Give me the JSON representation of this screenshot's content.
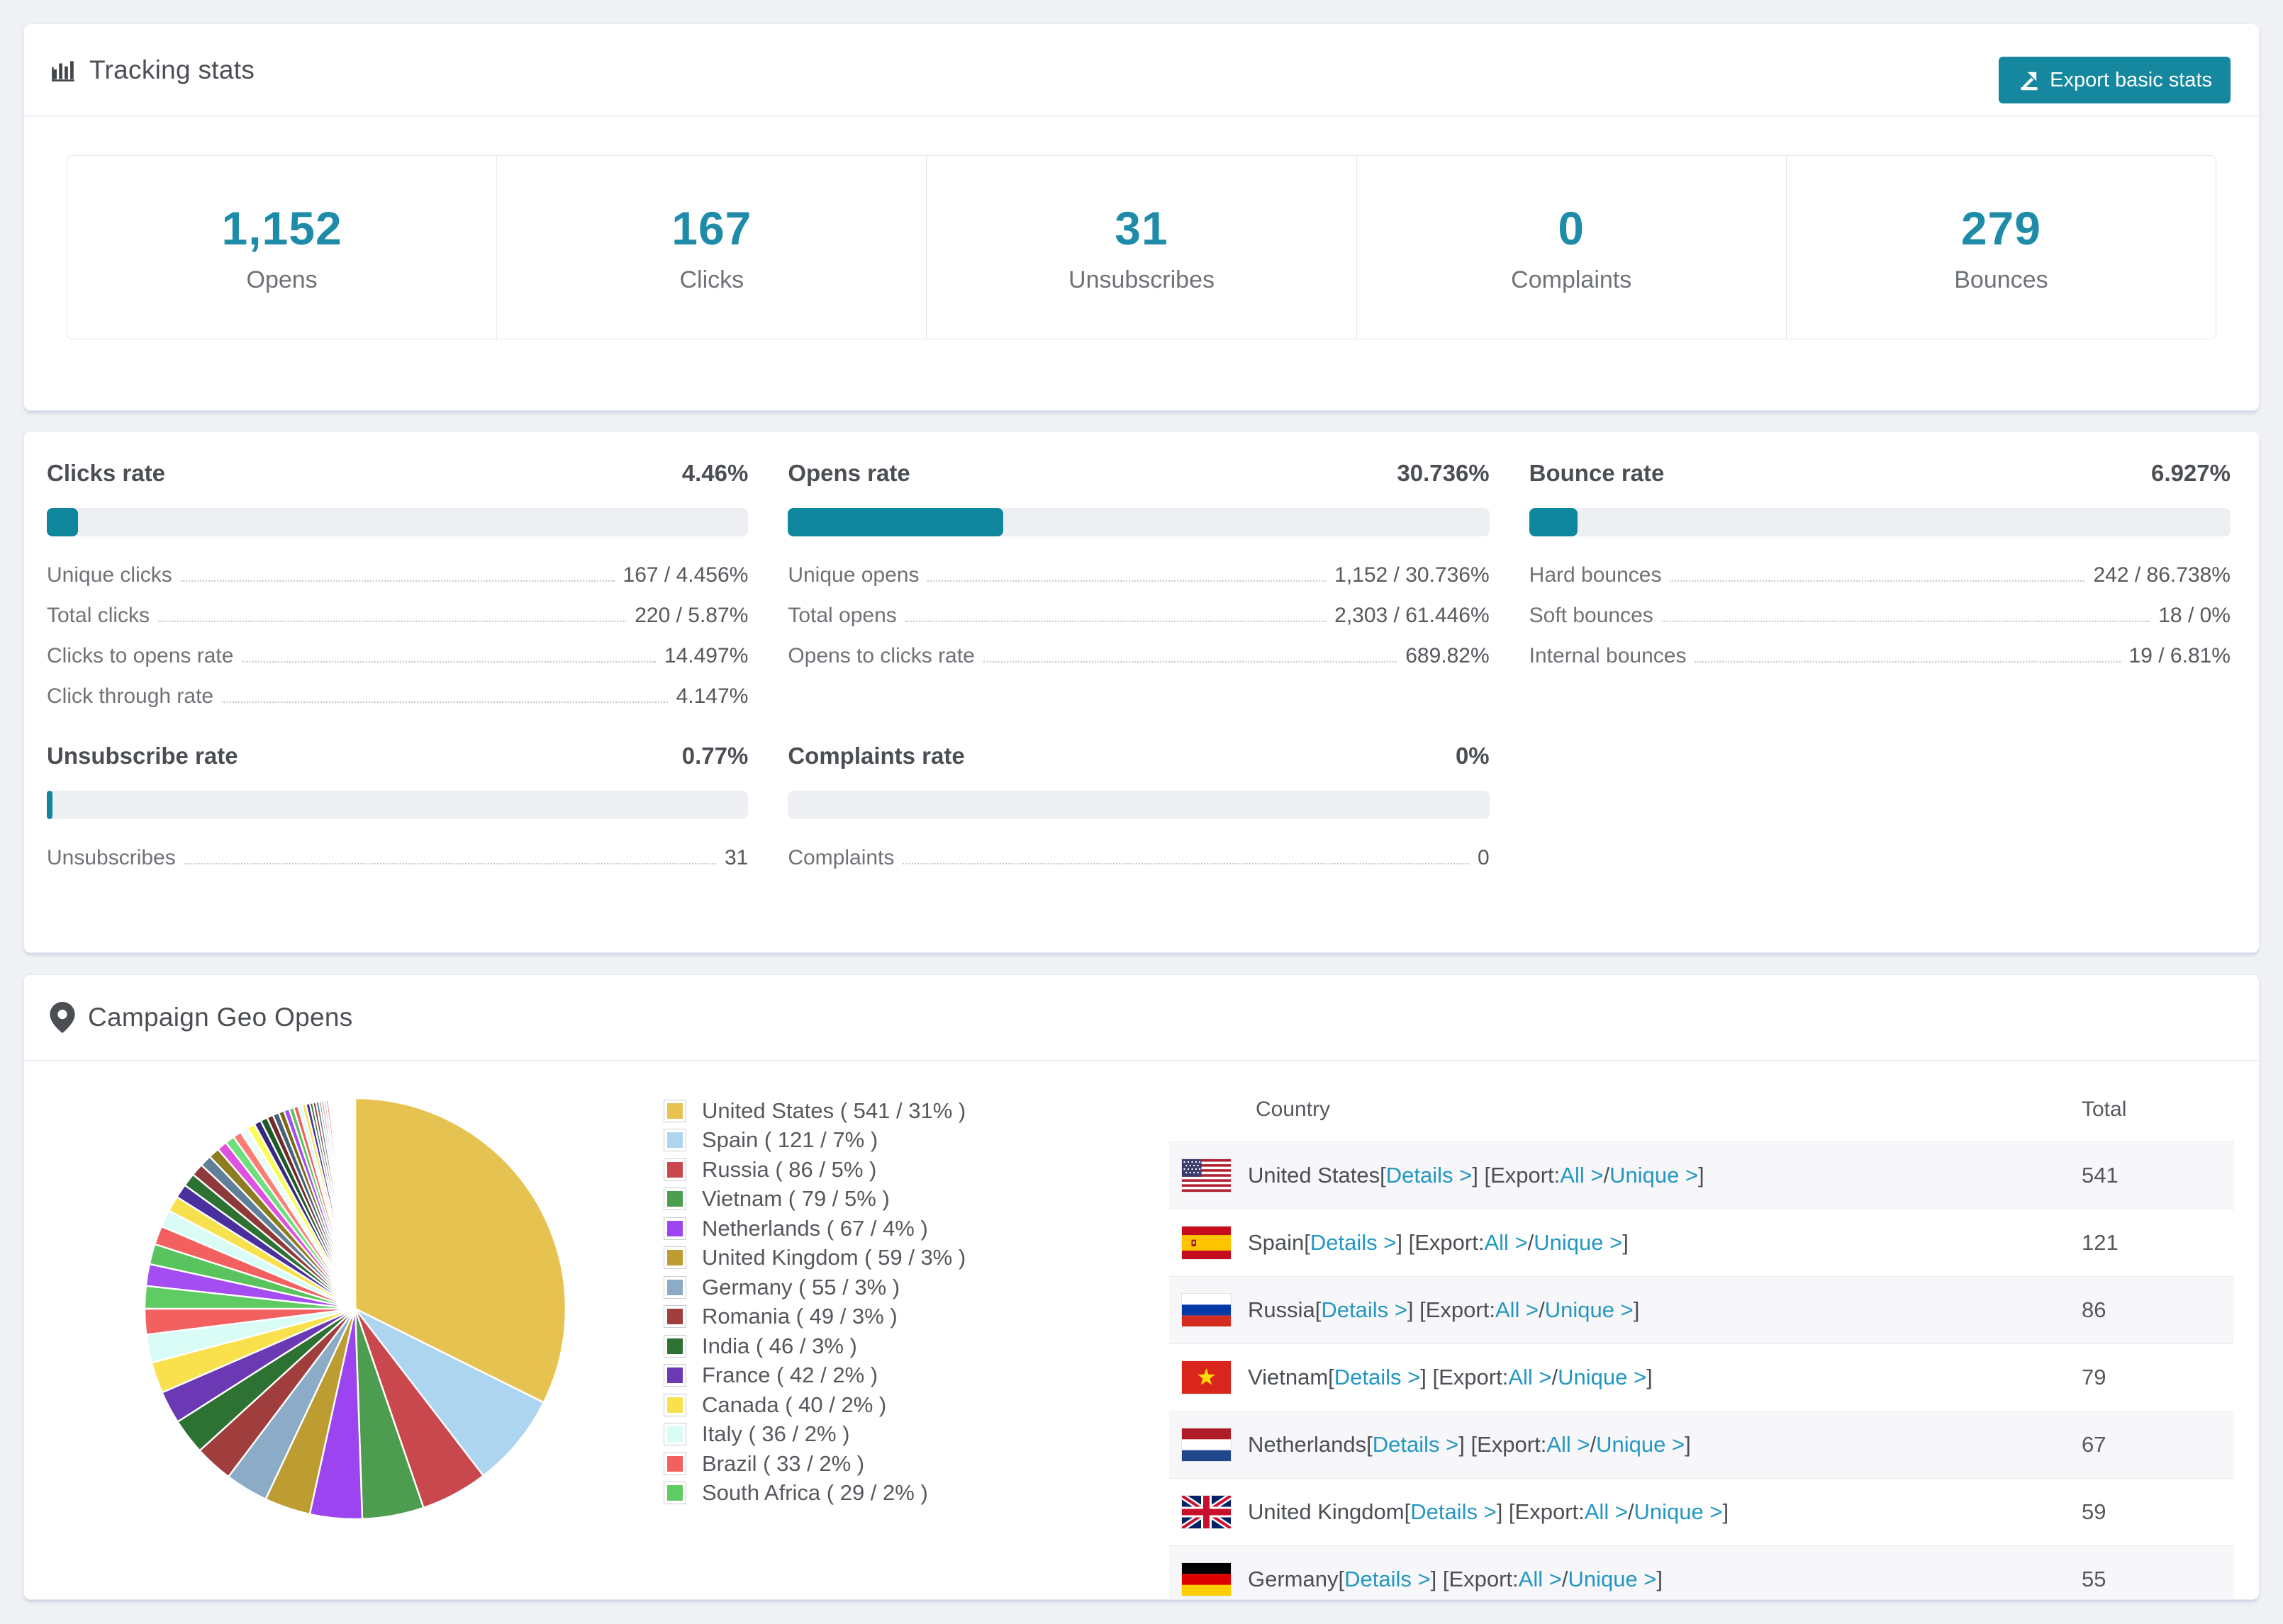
{
  "tracking": {
    "title": "Tracking stats",
    "export_button": "Export basic stats",
    "stats": [
      {
        "value": "1,152",
        "label": "Opens"
      },
      {
        "value": "167",
        "label": "Clicks"
      },
      {
        "value": "31",
        "label": "Unsubscribes"
      },
      {
        "value": "0",
        "label": "Complaints"
      },
      {
        "value": "279",
        "label": "Bounces"
      }
    ]
  },
  "rates": {
    "blocks": [
      {
        "name": "Clicks rate",
        "value": "4.46%",
        "pct": 4.46,
        "rows": [
          {
            "label": "Unique clicks",
            "value": "167 / 4.456%"
          },
          {
            "label": "Total clicks",
            "value": "220 / 5.87%"
          },
          {
            "label": "Clicks to opens rate",
            "value": "14.497%"
          },
          {
            "label": "Click through rate",
            "value": "4.147%"
          }
        ]
      },
      {
        "name": "Opens rate",
        "value": "30.736%",
        "pct": 30.736,
        "rows": [
          {
            "label": "Unique opens",
            "value": "1,152 / 30.736%"
          },
          {
            "label": "Total opens",
            "value": "2,303 / 61.446%"
          },
          {
            "label": "Opens to clicks rate",
            "value": "689.82%"
          }
        ]
      },
      {
        "name": "Bounce rate",
        "value": "6.927%",
        "pct": 6.927,
        "rows": [
          {
            "label": "Hard bounces",
            "value": "242 / 86.738%"
          },
          {
            "label": "Soft bounces",
            "value": "18 / 0%"
          },
          {
            "label": "Internal bounces",
            "value": "19 / 6.81%"
          }
        ]
      },
      {
        "name": "Unsubscribe rate",
        "value": "0.77%",
        "pct": 0.77,
        "rows": [
          {
            "label": "Unsubscribes",
            "value": "31"
          }
        ]
      },
      {
        "name": "Complaints rate",
        "value": "0%",
        "pct": 0,
        "rows": [
          {
            "label": "Complaints",
            "value": "0"
          }
        ]
      }
    ],
    "accent_color": "#0e879d"
  },
  "geo": {
    "title": "Campaign Geo Opens",
    "legend": [
      {
        "label": "United States ( 541 / 31% )",
        "color": "#e6c350"
      },
      {
        "label": "Spain ( 121 / 7% )",
        "color": "#aed5f0"
      },
      {
        "label": "Russia ( 86 / 5% )",
        "color": "#c9484e"
      },
      {
        "label": "Vietnam ( 79 / 5% )",
        "color": "#4d9d51"
      },
      {
        "label": "Netherlands ( 67 / 4% )",
        "color": "#9b44f0"
      },
      {
        "label": "United Kingdom ( 59 / 3% )",
        "color": "#bd9c32"
      },
      {
        "label": "Germany ( 55 / 3% )",
        "color": "#8babc6"
      },
      {
        "label": "Romania ( 49 / 3% )",
        "color": "#a03e3e"
      },
      {
        "label": "India ( 46 / 3% )",
        "color": "#2e7233"
      },
      {
        "label": "France ( 42 / 2% )",
        "color": "#6c39b4"
      },
      {
        "label": "Canada ( 40 / 2% )",
        "color": "#f9e14e"
      },
      {
        "label": "Italy ( 36 / 2% )",
        "color": "#d9fcf6"
      },
      {
        "label": "Brazil ( 33 / 2% )",
        "color": "#f26060"
      },
      {
        "label": "South Africa ( 29 / 2% )",
        "color": "#5fcb63"
      }
    ],
    "table": {
      "col_country": "Country",
      "col_total": "Total",
      "links": {
        "l1": " [",
        "details": "Details >",
        "l2": "] [",
        "export": "Export: ",
        "all": "All >",
        "l3": " / ",
        "unique": "Unique >",
        "l4": "]"
      },
      "rows": [
        {
          "country": "United States",
          "total": "541",
          "flag_icon": "us-flag-icon"
        },
        {
          "country": "Spain",
          "total": "121",
          "flag_icon": "spain-flag-icon"
        },
        {
          "country": "Russia",
          "total": "86",
          "flag_icon": "russia-flag-icon"
        },
        {
          "country": "Vietnam",
          "total": "79",
          "flag_icon": "vietnam-flag-icon"
        },
        {
          "country": "Netherlands",
          "total": "67",
          "flag_icon": "netherlands-flag-icon"
        },
        {
          "country": "United Kingdom",
          "total": "59",
          "flag_icon": "uk-flag-icon"
        },
        {
          "country": "Germany",
          "total": "55",
          "flag_icon": "germany-flag-icon"
        }
      ]
    }
  },
  "chart_data": {
    "type": "pie",
    "title": "Campaign Geo Opens",
    "unit": "opens",
    "legend_position": "right",
    "series": [
      {
        "name": "United States",
        "value": 541,
        "pct": "31%",
        "color": "#e6c350"
      },
      {
        "name": "Spain",
        "value": 121,
        "pct": "7%",
        "color": "#aed5f0"
      },
      {
        "name": "Russia",
        "value": 86,
        "pct": "5%",
        "color": "#c9484e"
      },
      {
        "name": "Vietnam",
        "value": 79,
        "pct": "5%",
        "color": "#4d9d51"
      },
      {
        "name": "Netherlands",
        "value": 67,
        "pct": "4%",
        "color": "#9b44f0"
      },
      {
        "name": "United Kingdom",
        "value": 59,
        "pct": "3%",
        "color": "#bd9c32"
      },
      {
        "name": "Germany",
        "value": 55,
        "pct": "3%",
        "color": "#8babc6"
      },
      {
        "name": "Romania",
        "value": 49,
        "pct": "3%",
        "color": "#a03e3e"
      },
      {
        "name": "India",
        "value": 46,
        "pct": "3%",
        "color": "#2e7233"
      },
      {
        "name": "France",
        "value": 42,
        "pct": "2%",
        "color": "#6c39b4"
      },
      {
        "name": "Canada",
        "value": 40,
        "pct": "2%",
        "color": "#f9e14e"
      },
      {
        "name": "Italy",
        "value": 36,
        "pct": "2%",
        "color": "#d9fcf6"
      },
      {
        "name": "Brazil",
        "value": 33,
        "pct": "2%",
        "color": "#f26060"
      },
      {
        "name": "South Africa",
        "value": 29,
        "pct": "2%",
        "color": "#5fcb63"
      }
    ],
    "others": {
      "values": [
        28,
        26,
        24,
        22,
        20,
        18,
        17,
        16,
        15,
        14,
        13,
        12,
        11,
        10,
        10,
        9,
        9,
        8,
        8,
        7,
        7,
        6,
        6,
        5,
        5,
        5,
        4,
        4,
        4,
        3,
        3,
        3,
        3,
        2,
        2,
        2,
        2,
        2,
        2,
        2,
        1,
        1,
        1,
        1,
        1,
        1,
        1,
        1,
        1,
        1,
        1,
        1,
        1,
        1,
        1,
        1,
        1,
        1,
        1,
        1
      ],
      "palette": [
        "#a44df2",
        "#59c35d",
        "#f2615f",
        "#d9fcf6",
        "#f7e04e",
        "#4a2f9f",
        "#2e7233",
        "#8f3a3a",
        "#60809a",
        "#8d7d20",
        "#df52df",
        "#6fdf7d",
        "#fb7d74",
        "#eefbfb",
        "#fafc58",
        "#35297f",
        "#1c5a26",
        "#702a2a",
        "#46617a",
        "#7a6a16"
      ]
    }
  }
}
